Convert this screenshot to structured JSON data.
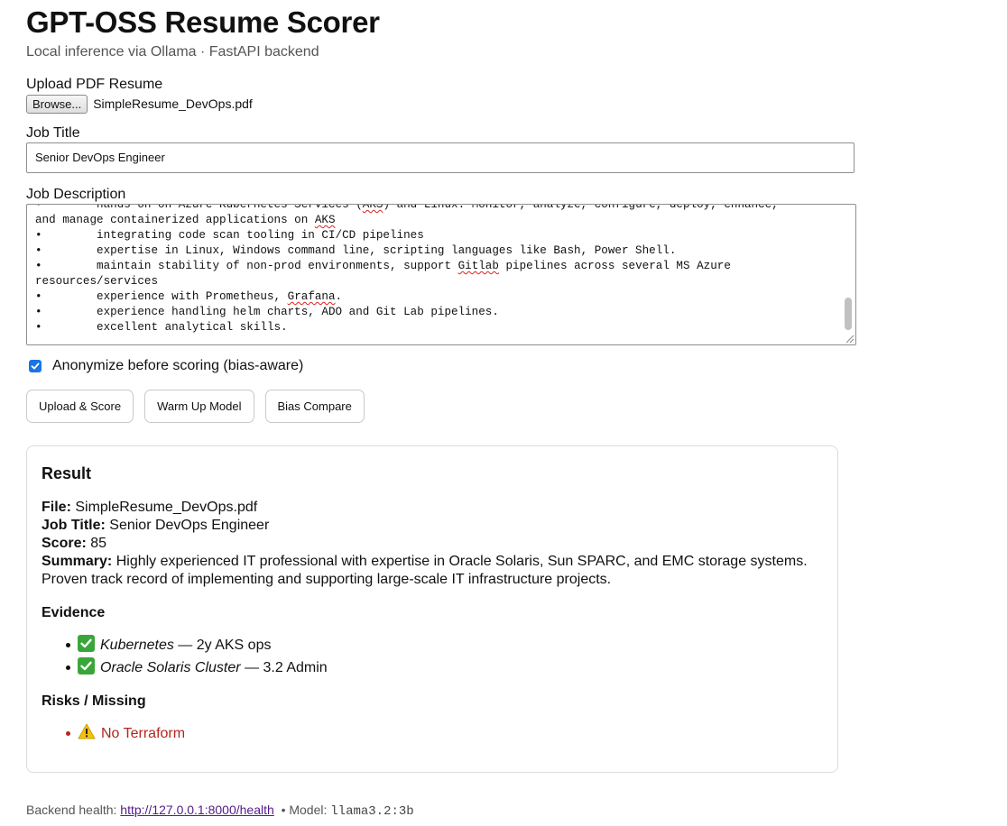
{
  "header": {
    "title": "GPT-OSS Resume Scorer",
    "subtitle": "Local inference via Ollama · FastAPI backend"
  },
  "form": {
    "upload_label": "Upload PDF Resume",
    "browse_label": "Browse...",
    "file_name": "SimpleResume_DevOps.pdf",
    "job_title_label": "Job Title",
    "job_title_value": "Senior DevOps Engineer",
    "job_description_label": "Job Description",
    "job_description_lines": [
      "•        hands-on on Azure Kubernetes Services (AKS) and Linux. Monitor, analyze, configure, deploy, enhance,",
      "and manage containerized applications on AKS",
      "•        integrating code scan tooling in CI/CD pipelines",
      "•        expertise in Linux, Windows command line, scripting languages like Bash, Power Shell.",
      "•        maintain stability of non-prod environments, support Gitlab pipelines across several MS Azure",
      "resources/services",
      "•        experience with Prometheus, Grafana.",
      "•        experience handling helm charts, ADO and Git Lab pipelines.",
      "•        excellent analytical skills."
    ],
    "anonymize_label": "Anonymize before scoring (bias-aware)",
    "anonymize_checked": true
  },
  "actions": {
    "upload_score": "Upload & Score",
    "warm_up": "Warm Up Model",
    "bias_compare": "Bias Compare"
  },
  "result": {
    "title": "Result",
    "file_key": "File:",
    "file_value": "SimpleResume_DevOps.pdf",
    "job_title_key": "Job Title:",
    "job_title_value": "Senior DevOps Engineer",
    "score_key": "Score:",
    "score_value": "85",
    "summary_key": "Summary:",
    "summary_value": "Highly experienced IT professional with expertise in Oracle Solaris, Sun SPARC, and EMC storage systems. Proven track record of implementing and supporting large-scale IT infrastructure projects.",
    "evidence_heading": "Evidence",
    "evidence": [
      {
        "skill": "Kubernetes",
        "detail": "— 2y AKS ops"
      },
      {
        "skill": "Oracle Solaris Cluster",
        "detail": "— 3.2 Admin"
      }
    ],
    "risks_heading": "Risks / Missing",
    "risks": [
      "No Terraform"
    ]
  },
  "footer": {
    "health_label": "Backend health:",
    "health_url": "http://127.0.0.1:8000/health",
    "model_label": "• Model:",
    "model_value": "llama3.2:3b"
  },
  "colors": {
    "accent": "#1a73e8",
    "risk": "#b3261e",
    "link": "#551a8b",
    "check_green": "#3aa63a"
  }
}
